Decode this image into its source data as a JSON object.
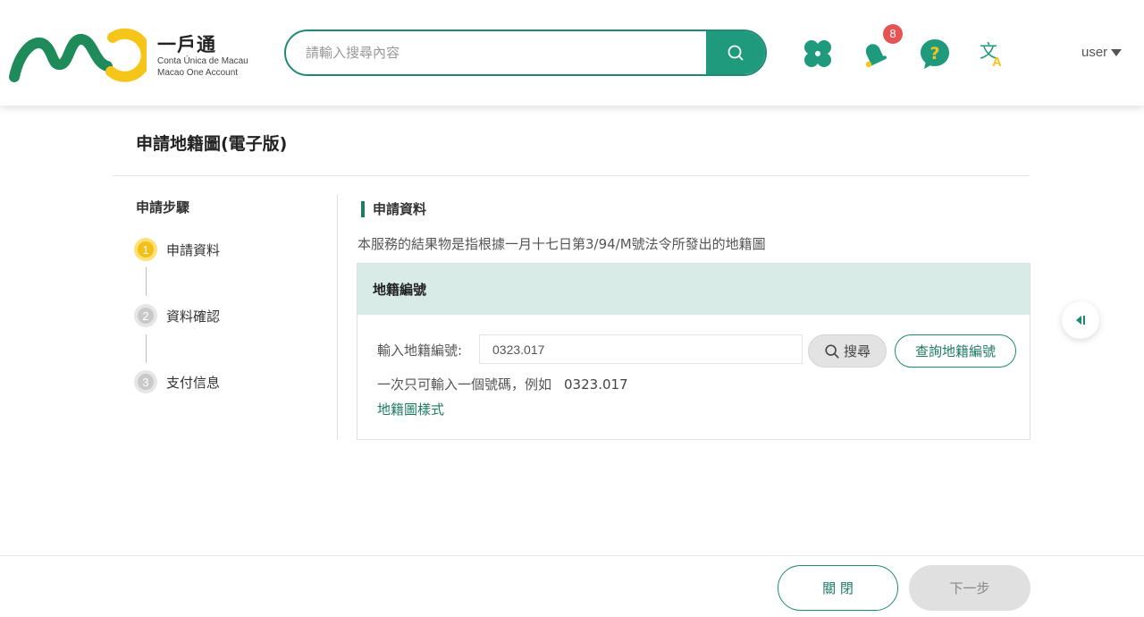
{
  "header": {
    "brand_zh": "一戶通",
    "brand_pt": "Conta Única de Macau",
    "brand_en": "Macao One Account",
    "search_placeholder": "請輸入搜尋內容",
    "notification_count": "8",
    "user_label": "user",
    "icons": [
      "clover-icon",
      "bell-icon",
      "help-icon",
      "translate-icon",
      "search-icon"
    ]
  },
  "page": {
    "title": "申請地籍圖(電子版)"
  },
  "steps": {
    "title": "申請步驟",
    "items": [
      {
        "num": "1",
        "label": "申請資料",
        "state": "active"
      },
      {
        "num": "2",
        "label": "資料確認",
        "state": "pending"
      },
      {
        "num": "3",
        "label": "支付信息",
        "state": "pending"
      }
    ]
  },
  "main": {
    "section_title": "申請資料",
    "description": "本服務的結果物是指根據一月十七日第3/94/M號法令所發出的地籍圖",
    "card": {
      "header": "地籍編號",
      "field_label": "輸入地籍編號:",
      "field_value": "0323.017",
      "search_button": "搜尋",
      "lookup_button": "查詢地籍編號",
      "hint": "一次只可輸入一個號碼，例如",
      "hint_example": "0323.017",
      "style_link": "地籍圖樣式"
    }
  },
  "footer": {
    "close_button": "關 閉",
    "next_button": "下一步"
  },
  "colors": {
    "primary": "#1f9a7c",
    "primary_dark": "#1f7a63",
    "card_header_bg": "#d9ebe6",
    "step_active": "#f5bf16",
    "badge": "#e65353"
  }
}
